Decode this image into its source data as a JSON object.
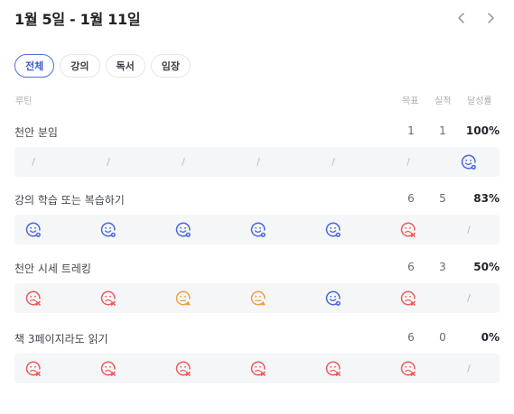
{
  "header": {
    "title": "1월 5일 - 1월 11일"
  },
  "filters": [
    "전체",
    "강의",
    "독서",
    "임장"
  ],
  "active_filter_index": 0,
  "columns": {
    "routine": "루틴",
    "goal": "목표",
    "actual": "실적",
    "rate": "달성률"
  },
  "colors": {
    "accent": "#4c6fde",
    "success": "#4a66e0",
    "fail": "#ef5a5a",
    "warning": "#f0a043",
    "slash": "#b7bbc2",
    "row_bg": "#f5f6f8"
  },
  "routines": [
    {
      "name": "천안 분임",
      "goal": "1",
      "actual": "1",
      "rate": "100%",
      "days": [
        "empty",
        "empty",
        "empty",
        "empty",
        "empty",
        "empty",
        "success"
      ]
    },
    {
      "name": "강의 학습 또는 복습하기",
      "goal": "6",
      "actual": "5",
      "rate": "83%",
      "days": [
        "success",
        "success",
        "success",
        "success",
        "success",
        "fail",
        "empty"
      ]
    },
    {
      "name": "천안 시세 트레킹",
      "goal": "6",
      "actual": "3",
      "rate": "50%",
      "days": [
        "fail",
        "fail",
        "warning",
        "warning",
        "success",
        "fail",
        "empty"
      ]
    },
    {
      "name": "책 3페이지라도 읽기",
      "goal": "6",
      "actual": "0",
      "rate": "0%",
      "days": [
        "fail",
        "fail",
        "fail",
        "fail",
        "fail",
        "fail",
        "empty"
      ]
    }
  ],
  "empty_mark": "/"
}
